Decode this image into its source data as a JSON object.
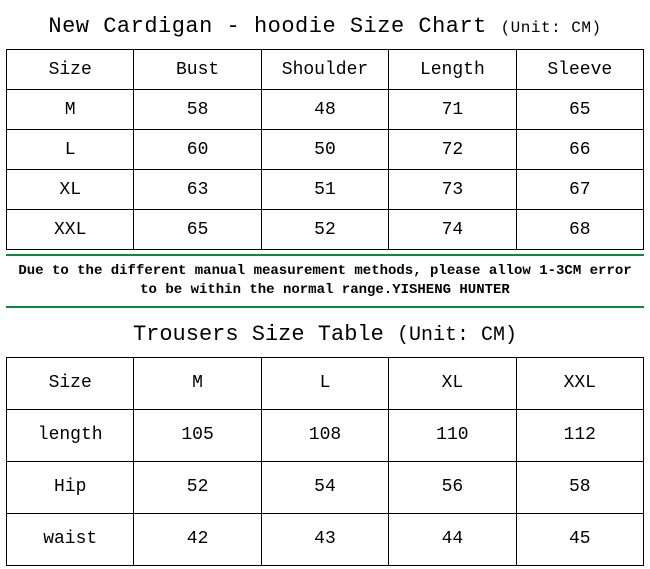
{
  "chart_data": [
    {
      "type": "table",
      "title": "New Cardigan - hoodie Size Chart",
      "unit": "(Unit: CM)",
      "headers": [
        "Size",
        "Bust",
        "Shoulder",
        "Length",
        "Sleeve"
      ],
      "rows": [
        [
          "M",
          "58",
          "48",
          "71",
          "65"
        ],
        [
          "L",
          "60",
          "50",
          "72",
          "66"
        ],
        [
          "XL",
          "63",
          "51",
          "73",
          "67"
        ],
        [
          "XXL",
          "65",
          "52",
          "74",
          "68"
        ]
      ]
    },
    {
      "type": "table",
      "title": "Trousers Size Table",
      "unit": "(Unit: CM)",
      "headers": [
        "Size",
        "M",
        "L",
        "XL",
        "XXL"
      ],
      "rows": [
        [
          "length",
          "105",
          "108",
          "110",
          "112"
        ],
        [
          "Hip",
          "52",
          "54",
          "56",
          "58"
        ],
        [
          "waist",
          "42",
          "43",
          "44",
          "45"
        ]
      ]
    }
  ],
  "note": "Due to the different manual measurement methods, please allow 1-3CM error to be within the normal range.YISHENG HUNTER"
}
